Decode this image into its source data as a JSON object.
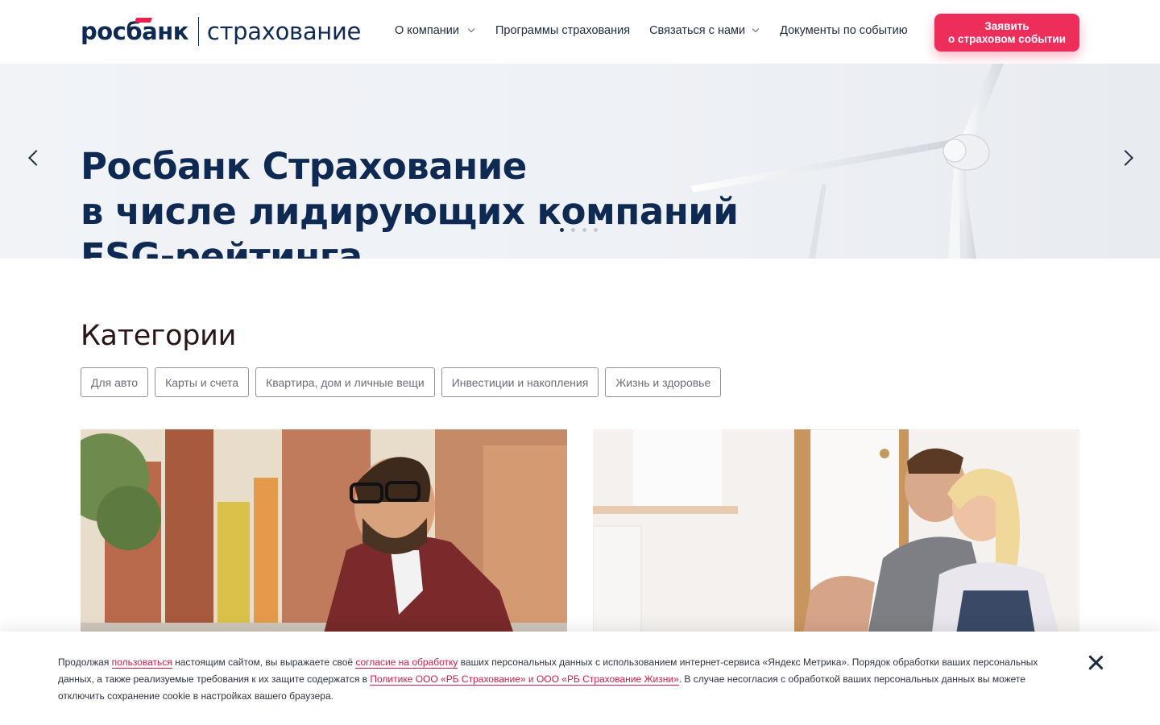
{
  "header": {
    "logo_brand": "росбанк",
    "logo_sub": "страхование",
    "nav": [
      {
        "label": "О компании",
        "dropdown": true
      },
      {
        "label": "Программы страхования",
        "dropdown": false
      },
      {
        "label": "Связаться с нами",
        "dropdown": true
      },
      {
        "label": "Документы по событию",
        "dropdown": false
      }
    ],
    "cta_line1": "Заявить",
    "cta_line2": "о страховом событии"
  },
  "hero": {
    "line1": "Росбанк Страхование",
    "line2": "в числе лидирующих компаний",
    "line3": "ESG-рейтинга",
    "slides_count": 4,
    "active_slide": 1
  },
  "categories": {
    "title": "Категории",
    "chips": [
      "Для авто",
      "Карты и счета",
      "Квартира, дом и личные вещи",
      "Инвестиции и накопления",
      "Жизнь и здоровье"
    ]
  },
  "cookie": {
    "t1": "Продолжая ",
    "l1": "пользоваться",
    "t2": " настоящим сайтом, вы выражаете своё ",
    "l2": "согласие на обработку",
    "t3": " ваших персональных данных с использованием интернет-сервиса «Яндекс Метрика». Порядок обработки ваших персональных данных, а также реализуемые требования к их защите содержатся в ",
    "l3": "Политике ООО «РБ Страхование» и ООО «РБ Страхование Жизни»",
    "t4": ". В случае несогласия с обработкой ваших персональных данных вы можете отключить сохранение cookie в настройках вашего браузера."
  },
  "colors": {
    "brand": "#0f2a52",
    "accent": "#ee2e5a"
  }
}
